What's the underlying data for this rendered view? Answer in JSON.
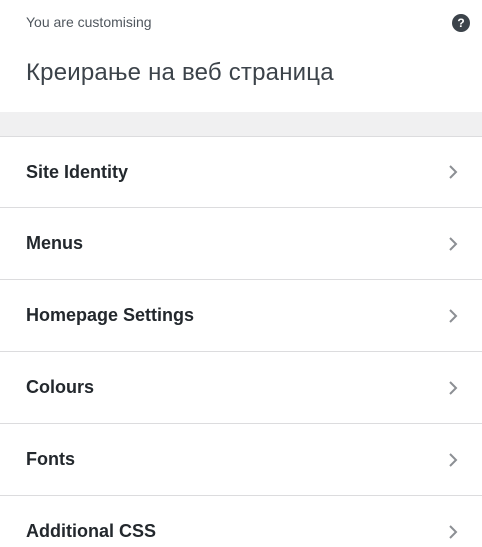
{
  "header": {
    "customising_label": "You are customising",
    "site_title": "Креирање на веб страница",
    "help_icon": "question-mark-icon",
    "help_glyph": "?"
  },
  "menu": {
    "items": [
      {
        "label": "Site Identity",
        "icon": "chevron-right-icon"
      },
      {
        "label": "Menus",
        "icon": "chevron-right-icon"
      },
      {
        "label": "Homepage Settings",
        "icon": "chevron-right-icon"
      },
      {
        "label": "Colours",
        "icon": "chevron-right-icon"
      },
      {
        "label": "Fonts",
        "icon": "chevron-right-icon"
      },
      {
        "label": "Additional CSS",
        "icon": "chevron-right-icon"
      }
    ]
  },
  "colors": {
    "background": "#ffffff",
    "divider_band": "#f0f0f1",
    "text_primary": "#23282d",
    "text_muted": "#50575e",
    "border": "#dcdcde",
    "chevron": "#8c8f94"
  }
}
